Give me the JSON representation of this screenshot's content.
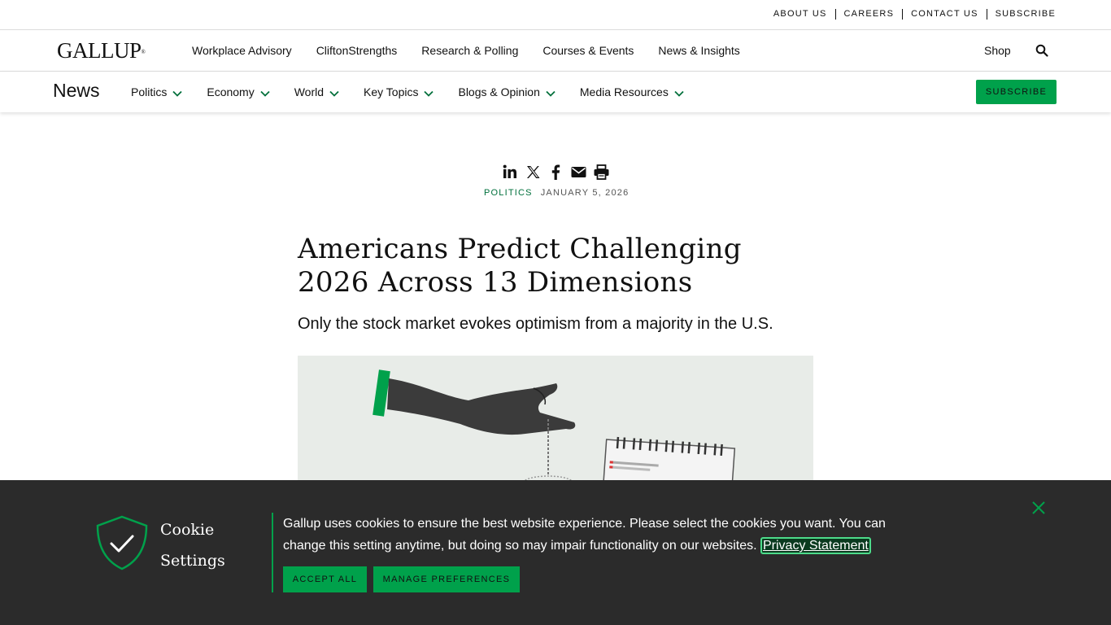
{
  "utility": {
    "links": [
      "ABOUT US",
      "CAREERS",
      "CONTACT US",
      "SUBSCRIBE"
    ]
  },
  "header": {
    "logo": "GALLUP",
    "logo_mark": "®",
    "nav": [
      "Workplace Advisory",
      "CliftonStrengths",
      "Research & Polling",
      "Courses & Events",
      "News & Insights"
    ],
    "shop": "Shop",
    "search_icon": "search-icon"
  },
  "subnav": {
    "section": "News",
    "items": [
      "Politics",
      "Economy",
      "World",
      "Key Topics",
      "Blogs & Opinion",
      "Media Resources"
    ],
    "subscribe": "SUBSCRIBE"
  },
  "article": {
    "share_icons": [
      "linkedin-icon",
      "x-icon",
      "facebook-icon",
      "email-icon",
      "print-icon"
    ],
    "category": "POLITICS",
    "date": "JANUARY 5, 2026",
    "headline": "Americans Predict Challenging 2026 Across 13 Dimensions",
    "subheadline": "Only the stock market evokes optimism from a majority in the U.S."
  },
  "cookie": {
    "title": "Cookie Settings",
    "text": "Gallup uses cookies to ensure the best website experience. Please select the cookies you want. You can change this setting anytime, but doing so may impair functionality on our websites.",
    "privacy_link": "Privacy Statement",
    "accept": "ACCEPT ALL",
    "manage": "MANAGE PREFERENCES"
  },
  "colors": {
    "accent_green": "#00a14b",
    "category_green": "#00703c",
    "banner_bg": "#2b2b2b"
  }
}
